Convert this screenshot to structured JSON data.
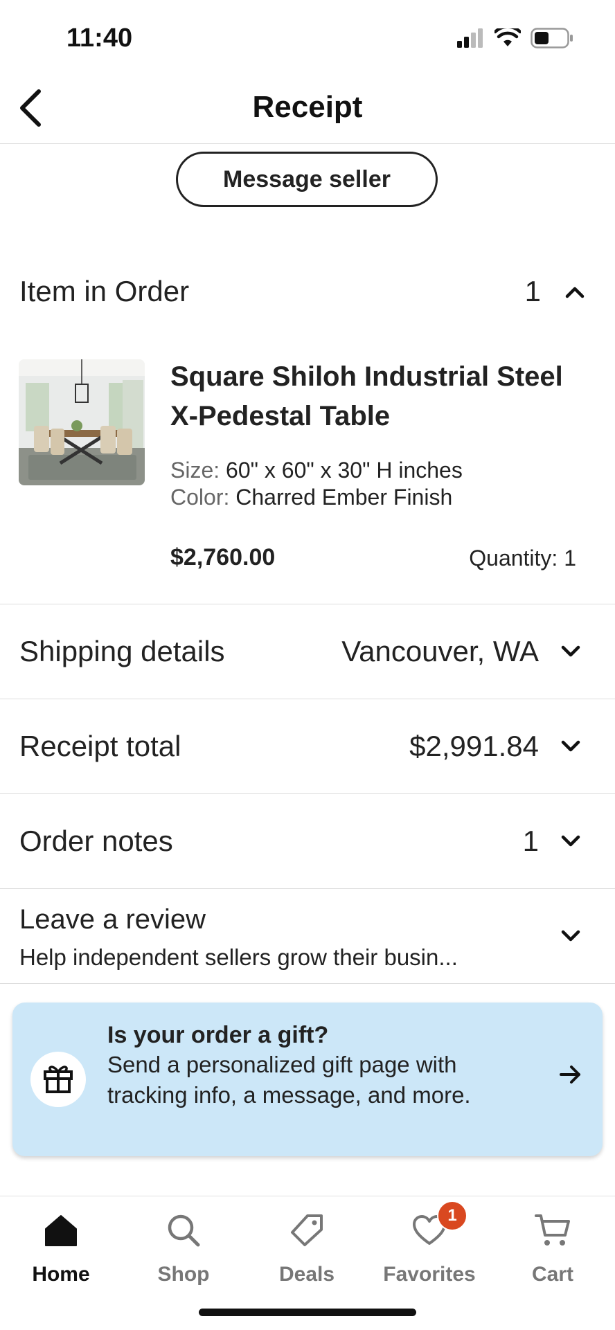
{
  "status_bar": {
    "time": "11:40"
  },
  "header": {
    "title": "Receipt"
  },
  "actions": {
    "message_seller": "Message seller"
  },
  "items_section": {
    "title": "Item in Order",
    "count": "1"
  },
  "product": {
    "name": "Square Shiloh Industrial Steel X-Pedestal Table",
    "size_label": "Size:",
    "size_value": "60\" x 60\" x 30\" H inches",
    "color_label": "Color:",
    "color_value": "Charred Ember Finish",
    "price": "$2,760.00",
    "quantity": "Quantity: 1"
  },
  "shipping": {
    "title": "Shipping details",
    "value": "Vancouver, WA"
  },
  "receipt_total": {
    "title": "Receipt total",
    "value": "$2,991.84"
  },
  "order_notes": {
    "title": "Order notes",
    "value": "1"
  },
  "review": {
    "title": "Leave a review",
    "subtitle": "Help independent sellers grow their busin..."
  },
  "gift": {
    "title": "Is your order a gift?",
    "body": "Send a personalized gift page with tracking info, a message, and more."
  },
  "tabbar": {
    "home": "Home",
    "shop": "Shop",
    "deals": "Deals",
    "favorites": "Favorites",
    "favorites_badge": "1",
    "cart": "Cart"
  },
  "colors": {
    "gift_card_bg": "#cce7f8",
    "badge": "#d94820",
    "divider": "#dddddd"
  }
}
